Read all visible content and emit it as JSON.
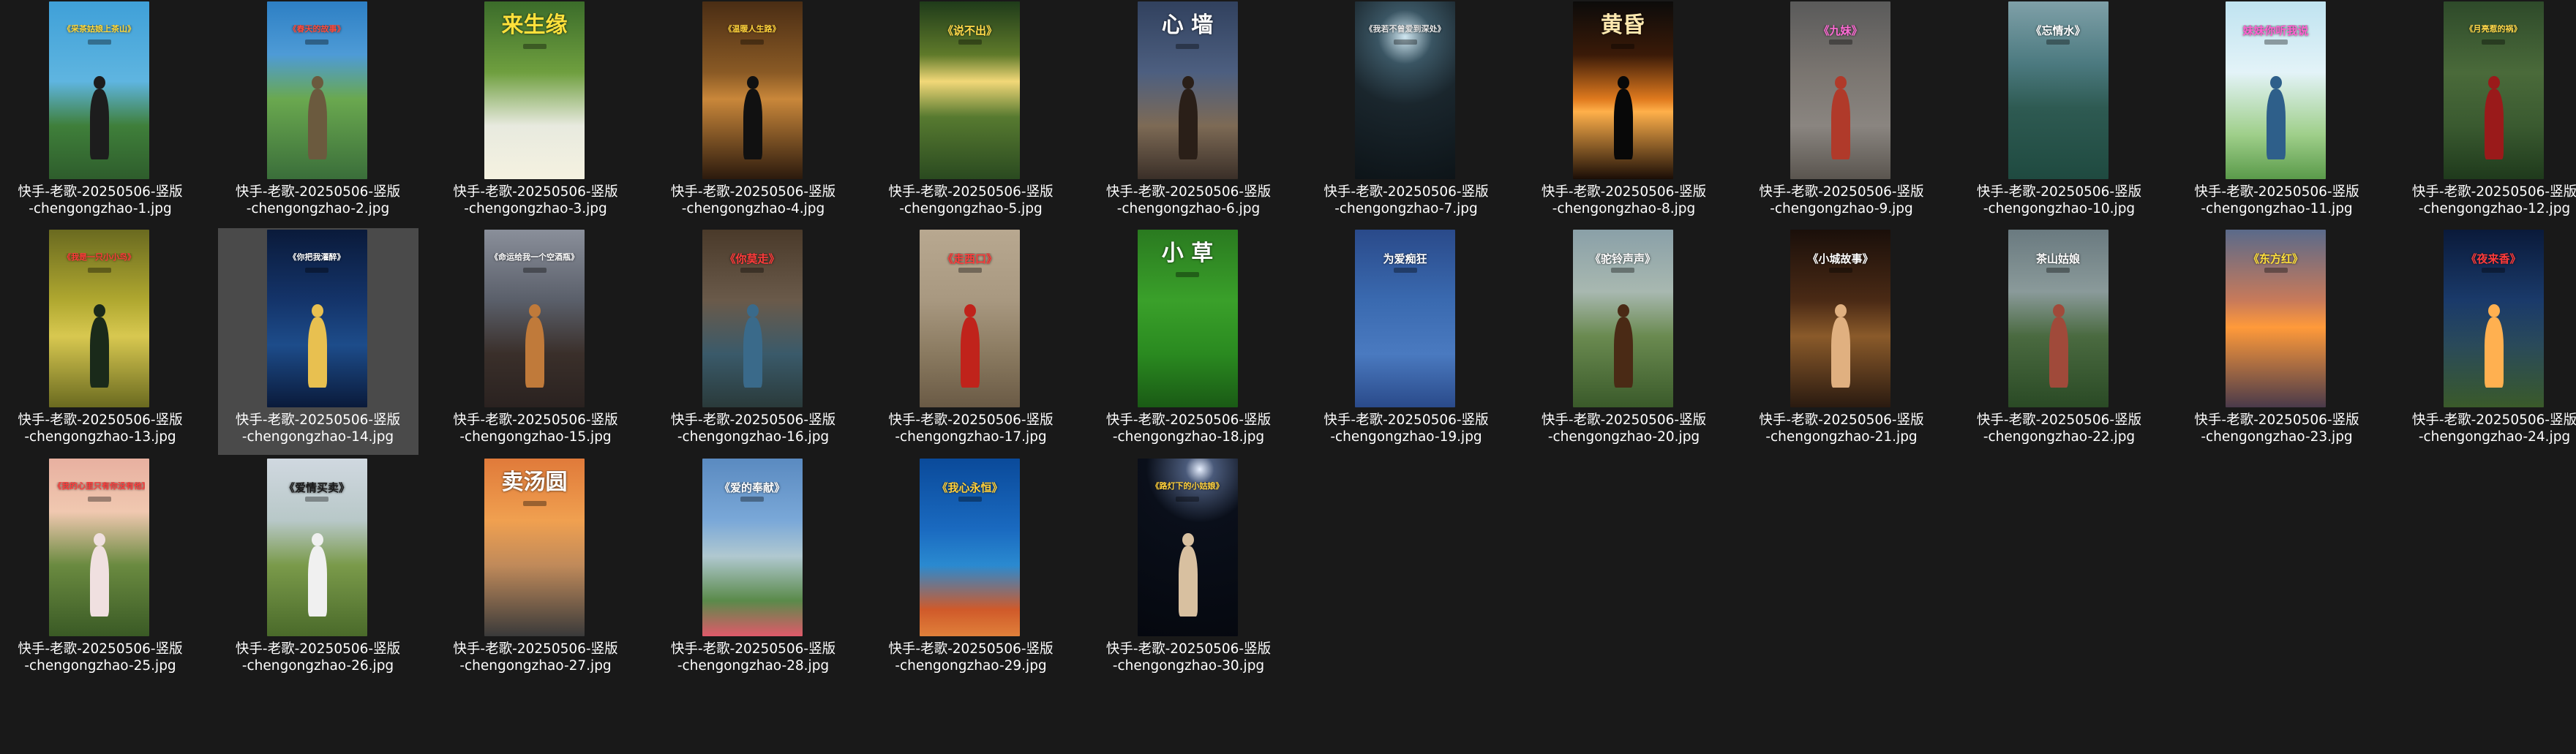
{
  "folder": {
    "files": [
      {
        "line1": "快手-老歌-20250506-竖版",
        "line2": "-chengongzhao-1.jpg",
        "thumb_title": "《采茶姑娘上茶山》",
        "thumb_sub": "快乐欣赏",
        "title_color": "#ffd93b",
        "bg": "linear-gradient(180deg,#3fa0d8 0%,#5fb5e0 45%,#3f7f3a 70%,#2e5d2c 100%)",
        "figure": "#1d1d1d"
      },
      {
        "line1": "快手-老歌-20250506-竖版",
        "line2": "-chengongzhao-2.jpg",
        "thumb_title": "《春天的故事》",
        "thumb_sub": "",
        "title_color": "#ff4c3c",
        "bg": "linear-gradient(180deg,#2d7fc4 0%,#4e9bd6 30%,#6aa84f 55%,#3a6e3a 100%)",
        "figure": "#6b5a3e"
      },
      {
        "line1": "快手-老歌-20250506-竖版",
        "line2": "-chengongzhao-3.jpg",
        "thumb_title": "来生缘",
        "thumb_sub": "",
        "title_color": "#ffe13b",
        "bg": "linear-gradient(180deg,#3b6c2a 0%,#6f9f3f 40%,#e8eadf 70%,#f5f2e0 100%)",
        "figure": ""
      },
      {
        "line1": "快手-老歌-20250506-竖版",
        "line2": "-chengongzhao-4.jpg",
        "thumb_title": "《温暖人生路》",
        "thumb_sub": "",
        "title_color": "#ffd23b",
        "bg": "linear-gradient(180deg,#4a2d14 0%,#8a5a25 40%,#c9873a 55%,#2b1a0d 100%)",
        "figure": "#111111"
      },
      {
        "line1": "快手-老歌-20250506-竖版",
        "line2": "-chengongzhao-5.jpg",
        "thumb_title": "《说不出》",
        "thumb_sub": "",
        "title_color": "#ffd94a",
        "bg": "linear-gradient(180deg,#1f3b1a 0%,#5f7a2a 30%,#f2d878 45%,#577a30 65%,#2a4a20 100%)",
        "figure": ""
      },
      {
        "line1": "快手-老歌-20250506-竖版",
        "line2": "-chengongzhao-6.jpg",
        "thumb_title": "心 墙",
        "thumb_sub": "",
        "title_color": "#ffffff",
        "bg": "linear-gradient(180deg,#31415e 0%,#4d5f80 40%,#7d6a55 70%,#3a2f28 100%)",
        "figure": "#2a1f18"
      },
      {
        "line1": "快手-老歌-20250506-竖版",
        "line2": "-chengongzhao-7.jpg",
        "thumb_title": "《我若不曾爱到深处》",
        "thumb_sub": "",
        "title_color": "#e8e8e8",
        "bg": "radial-gradient(circle at 50% 20%,#cfe6f0 0%,#3a5563 18%,#1a262d 45%,#0d1418 100%)",
        "figure": ""
      },
      {
        "line1": "快手-老歌-20250506-竖版",
        "line2": "-chengongzhao-8.jpg",
        "thumb_title": "黄昏",
        "thumb_sub": "",
        "title_color": "#ffe9b0",
        "bg": "linear-gradient(180deg,#0c0b0a 0%,#3a1a08 30%,#e07a1e 55%,#ffb04a 62%,#1a0d06 100%)",
        "figure": "#080808"
      },
      {
        "line1": "快手-老歌-20250506-竖版",
        "line2": "-chengongzhao-9.jpg",
        "thumb_title": "《九妹》",
        "thumb_sub": "",
        "title_color": "#ff6bd5",
        "bg": "linear-gradient(180deg,#5a5a5a 0%,#7a7570 40%,#8a8580 70%,#5a554f 100%)",
        "figure": "#b03a2a"
      },
      {
        "line1": "快手-老歌-20250506-竖版",
        "line2": "-chengongzhao-10.jpg",
        "thumb_title": "《忘情水》",
        "thumb_sub": "",
        "title_color": "#ffffff",
        "bg": "linear-gradient(180deg,#7fa0a8 0%,#4c7a80 35%,#2e5a52 60%,#1f4a40 100%)",
        "figure": ""
      },
      {
        "line1": "快手-老歌-20250506-竖版",
        "line2": "-chengongzhao-11.jpg",
        "thumb_title": "妹妹你听我说",
        "thumb_sub": "",
        "title_color": "#ff5fd0",
        "bg": "linear-gradient(180deg,#bfe3f0 0%,#e3f3f8 40%,#9fcf8a 75%,#5a9a4a 100%)",
        "figure": "#2e5f8a"
      },
      {
        "line1": "快手-老歌-20250506-竖版",
        "line2": "-chengongzhao-12.jpg",
        "thumb_title": "《月亮惹的祸》",
        "thumb_sub": "",
        "title_color": "#ffd84a",
        "bg": "linear-gradient(180deg,#2e4a2a 0%,#4a6a3a 40%,#3a5a30 70%,#1f3a1c 100%)",
        "figure": "#9a1a1a"
      },
      {
        "line1": "快手-老歌-20250506-竖版",
        "line2": "-chengongzhao-13.jpg",
        "thumb_title": "《我是一只小小鸟》",
        "thumb_sub": "",
        "title_color": "#ff3b3b",
        "bg": "linear-gradient(180deg,#6a6a20 0%,#b0a830 40%,#d8c850 60%,#6a6a20 100%)",
        "figure": "#1a2a1a"
      },
      {
        "line1": "快手-老歌-20250506-竖版",
        "line2": "-chengongzhao-14.jpg",
        "thumb_title": "《你把我灌醉》",
        "thumb_sub": "",
        "title_color": "#ffffff",
        "bg": "linear-gradient(180deg,#0a1a3a 0%,#14346a 40%,#1d4c8a 65%,#0a1a3a 100%)",
        "figure": "#e8c050",
        "selected": true
      },
      {
        "line1": "快手-老歌-20250506-竖版",
        "line2": "-chengongzhao-15.jpg",
        "thumb_title": "《命运给我一个空酒瓶》",
        "thumb_sub": "",
        "title_color": "#ffffff",
        "bg": "linear-gradient(180deg,#8a8f9a 0%,#5a5f6a 40%,#3a2f2a 70%,#2a2220 100%)",
        "figure": "#c07a3a"
      },
      {
        "line1": "快手-老歌-20250506-竖版",
        "line2": "-chengongzhao-16.jpg",
        "thumb_title": "《你莫走》",
        "thumb_sub": "",
        "title_color": "#ff3b3b",
        "bg": "linear-gradient(180deg,#4a3a2a 0%,#6a5a4a 40%,#3a5a6a 70%,#2a3a3a 100%)",
        "figure": "#3a6a8a"
      },
      {
        "line1": "快手-老歌-20250506-竖版",
        "line2": "-chengongzhao-17.jpg",
        "thumb_title": "《走西口》",
        "thumb_sub": "",
        "title_color": "#ff3b3b",
        "bg": "linear-gradient(180deg,#b8a890 0%,#a89880 40%,#8a7a60 70%,#6a5a45 100%)",
        "figure": "#c0231b"
      },
      {
        "line1": "快手-老歌-20250506-竖版",
        "line2": "-chengongzhao-18.jpg",
        "thumb_title": "小 草",
        "thumb_sub": "",
        "title_color": "#ffffff",
        "bg": "linear-gradient(180deg,#2a7a20 0%,#3aa02a 40%,#2a8a20 70%,#1a5a15 100%)",
        "figure": ""
      },
      {
        "line1": "快手-老歌-20250506-竖版",
        "line2": "-chengongzhao-19.jpg",
        "thumb_title": "为爱痴狂",
        "thumb_sub": "",
        "title_color": "#ffffff",
        "bg": "linear-gradient(180deg,#2a4a8a 0%,#3a6ab0 40%,#4a7ac0 70%,#2a4a8a 100%)",
        "figure": ""
      },
      {
        "line1": "快手-老歌-20250506-竖版",
        "line2": "-chengongzhao-20.jpg",
        "thumb_title": "《驼铃声声》",
        "thumb_sub": "",
        "title_color": "#ffffff",
        "bg": "linear-gradient(180deg,#8aa0a8 0%,#a8b8b0 35%,#6a8a50 60%,#3a5a2a 100%)",
        "figure": "#4a2a15"
      },
      {
        "line1": "快手-老歌-20250506-竖版",
        "line2": "-chengongzhao-21.jpg",
        "thumb_title": "《小城故事》",
        "thumb_sub": "",
        "title_color": "#ffffff",
        "bg": "linear-gradient(180deg,#1a0f0a 0%,#4a2a15 40%,#8a5a2a 60%,#2a1a10 100%)",
        "figure": "#e0b080"
      },
      {
        "line1": "快手-老歌-20250506-竖版",
        "line2": "-chengongzhao-22.jpg",
        "thumb_title": "茶山姑娘",
        "thumb_sub": "",
        "title_color": "#ffffff",
        "bg": "linear-gradient(180deg,#6a7a80 0%,#8a9a9a 35%,#4a6a40 60%,#2a4a25 100%)",
        "figure": "#a04a3a"
      },
      {
        "line1": "快手-老歌-20250506-竖版",
        "line2": "-chengongzhao-23.jpg",
        "thumb_title": "《东方红》",
        "thumb_sub": "",
        "title_color": "#ffe03b",
        "bg": "linear-gradient(180deg,#5a6a8a 0%,#c87a5a 40%,#ff9a3a 55%,#4a3a4a 100%)",
        "figure": ""
      },
      {
        "line1": "快手-老歌-20250506-竖版",
        "line2": "-chengongzhao-24.jpg",
        "thumb_title": "《夜来香》",
        "thumb_sub": "",
        "title_color": "#ff3b3b",
        "bg": "linear-gradient(180deg,#0a1a3a 0%,#1a3a6a 40%,#2a4a5a 65%,#3a5a2a 100%)",
        "figure": "#ffb050"
      },
      {
        "line1": "快手-老歌-20250506-竖版",
        "line2": "-chengongzhao-25.jpg",
        "thumb_title": "《我的心里只有你没有他》",
        "thumb_sub": "",
        "title_color": "#ff3b3b",
        "bg": "linear-gradient(180deg,#e8b0a0 0%,#f0c8b0 30%,#6a8a40 60%,#3a5a25 100%)",
        "figure": "#f0e0e0"
      },
      {
        "line1": "快手-老歌-20250506-竖版",
        "line2": "-chengongzhao-26.jpg",
        "thumb_title": "《爱情买卖》",
        "thumb_sub": "",
        "title_color": "#1a1a1a",
        "bg": "linear-gradient(180deg,#d0d8e0 0%,#b8c8c8 35%,#7a9a4a 60%,#4a6a2a 100%)",
        "figure": "#f0f0f0"
      },
      {
        "line1": "快手-老歌-20250506-竖版",
        "line2": "-chengongzhao-27.jpg",
        "thumb_title": "卖汤圆",
        "thumb_sub": "",
        "title_color": "#ffffff",
        "bg": "linear-gradient(180deg,#e07a3a 0%,#f0a050 35%,#c08a5a 60%,#3a3a3a 100%)",
        "figure": ""
      },
      {
        "line1": "快手-老歌-20250506-竖版",
        "line2": "-chengongzhao-28.jpg",
        "thumb_title": "《爱的奉献》",
        "thumb_sub": "",
        "title_color": "#ffffff",
        "bg": "linear-gradient(180deg,#5a8ac0 0%,#7aa8d8 35%,#b0c8d0 55%,#5a8a4a 80%,#e05a6a 100%)",
        "figure": ""
      },
      {
        "line1": "快手-老歌-20250506-竖版",
        "line2": "-chengongzhao-29.jpg",
        "thumb_title": "《我心永恒》",
        "thumb_sub": "",
        "title_color": "#ffd03b",
        "bg": "linear-gradient(180deg,#0a4a9a 0%,#1a6ac0 40%,#2a8ad0 60%,#d05a2a 85%,#e0803a 100%)",
        "figure": ""
      },
      {
        "line1": "快手-老歌-20250506-竖版",
        "line2": "-chengongzhao-30.jpg",
        "thumb_title": "《路灯下的小姑娘》",
        "thumb_sub": "",
        "title_color": "#ffd03b",
        "bg": "radial-gradient(circle at 62% 6%,#e8f0ff 0%,#4a5a7a 8%,#0a0f1a 30%,#05080f 100%)",
        "figure": "#d8c0a0"
      }
    ]
  }
}
